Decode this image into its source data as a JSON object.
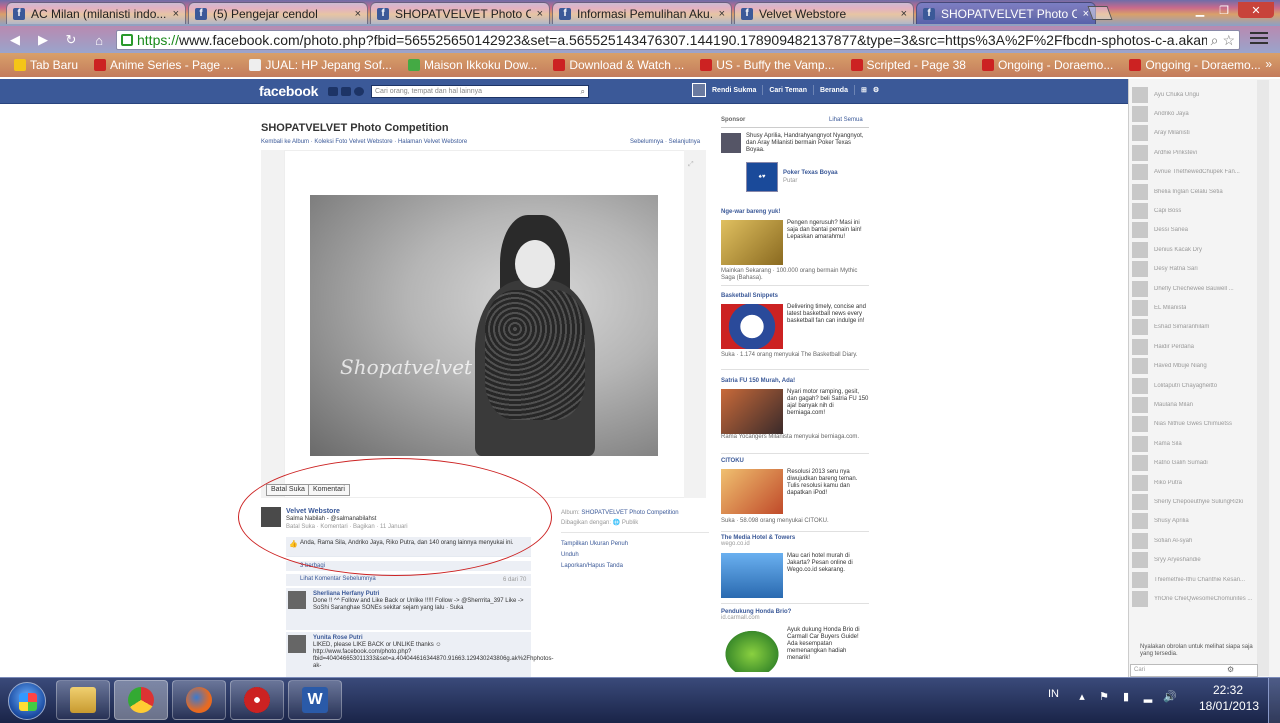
{
  "browser": {
    "tabs": [
      {
        "title": "AC Milan (milanisti indo..."
      },
      {
        "title": "(5) Pengejar cendol"
      },
      {
        "title": "SHOPATVELVET Photo C..."
      },
      {
        "title": "Informasi Pemulihan Aku..."
      },
      {
        "title": "Velvet Webstore"
      },
      {
        "title": "SHOPATVELVET Photo C..."
      }
    ],
    "close_glyph": "×",
    "url_scheme": "https://",
    "url_rest": "www.facebook.com/photo.php?fbid=565525650142923&set=a.565525143476307.144190.178909482137877&type=3&src=https%3A%2F%2Ffbcdn-sphotos-c-a.akam",
    "bookmarks": [
      {
        "label": "Tab Baru",
        "color": "#f5c518"
      },
      {
        "label": "Anime Series - Page ...",
        "color": "#cc2222"
      },
      {
        "label": "JUAL: HP Jepang Sof...",
        "color": "#eeeeee"
      },
      {
        "label": "Maison Ikkoku Dow...",
        "color": "#44aa44"
      },
      {
        "label": "Download & Watch ...",
        "color": "#cc2222"
      },
      {
        "label": "US - Buffy the Vamp...",
        "color": "#cc2222"
      },
      {
        "label": "Scripted - Page 38",
        "color": "#cc2222"
      },
      {
        "label": "Ongoing - Doraemo...",
        "color": "#cc2222"
      },
      {
        "label": "Ongoing - Doraemo...",
        "color": "#cc2222"
      }
    ],
    "bookmarks_more": "»"
  },
  "fb": {
    "logo": "facebook",
    "search_placeholder": "Cari orang, tempat dan hal lainnya",
    "nav_user": "Rendi Sukma",
    "nav_friends": "Cari Teman",
    "nav_home": "Beranda",
    "photo_title": "SHOPATVELVET Photo Competition",
    "breadcrumbs": "Kembali ke Album · Koleksi Foto Velvet Webstore · Halaman Velvet Webstore",
    "pager": "Sebelumnya · Selanjutnya",
    "watermark": "Shopatvelvet",
    "btn_unlike": "Batal Suka",
    "btn_comment": "Komentari",
    "poster_name": "Velvet Webstore",
    "poster_text": "Salma Nabilah - @salmanabilahst",
    "poster_meta": "Batal Suka · Komentari · Bagikan · 11 Januari",
    "likes_text": "Anda, Rama Sila, Andriko Jaya, Riko Putra, dan 140 orang lainnya menyukai ini.",
    "share_text": "3 berbagi",
    "prev_comments": "Lihat Komentar Sebelumnya",
    "prev_count": "6 dari 70",
    "album_label": "Album:",
    "album_name": "SHOPATVELVET Photo Competition",
    "shared_label": "Dibagikan dengan:",
    "shared_value": "Publik",
    "side_links": [
      "Tampilkan Ukuran Penuh",
      "Unduh",
      "Laporkan/Hapus Tanda"
    ],
    "comments": [
      {
        "name": "Sherliana Herfany Putri",
        "text": "Done !! ^^ Follow and Like Back or Unlike !!!!! Follow -> @Sherrrita_397 Like -> SoShi Saranghae SONEs sekitar sejam yang lalu · Suka",
        "highlight": "Done !! ^^"
      },
      {
        "name": "Yunita Rose Putri",
        "text": "LIKED, please LIKE BACK or UNLIKE thanks ☺ http://www.facebook.com/photo.php?fbid=404046653011333&set=a.404044616344870.91663.129430243806g.ak%2Fhphotos-ak-",
        "highlight": "LIKED, please LIKE BACK or UNLIKE thanks"
      }
    ]
  },
  "sponsor": {
    "head": "Sponsor",
    "see_all": "Lihat Semua",
    "social": {
      "name": "Shusy Aprilia",
      "text": "Shusy Aprilia, Handrahyangnyot Nyangnyot, dan Aray Milanisti bermain Poker Texas Boyaa."
    },
    "poker": {
      "name": "Poker Texas Boyaa",
      "action": "Putar"
    },
    "ads": [
      {
        "title": "Nge-war bareng yuk!",
        "sub": "",
        "desc": "Pengen ngerusuh? Masi ini saja dan bantai pemain lain! Lepaskan amarahmu!",
        "foot": "Mainkan Sekarang · 100.000 orang bermain Mythic Saga (Bahasa).",
        "color": "#c8a040"
      },
      {
        "title": "Basketball Snippets",
        "sub": "",
        "desc": "Delivering timely, concise and latest basketball news every basketball fan can indulge in!",
        "foot": "Suka · 1.174 orang menyukai The Basketball Diary.",
        "color": "#2a4a9a"
      },
      {
        "title": "Satria FU 150 Murah, Ada!",
        "sub": "",
        "desc": "Nyari motor ramping, gesit, dan gagah? beli Satria FU 150 aja! banyak nih di berniaga.com!",
        "foot": "Rama Yocangers Milanista menyukai berniaga.com.",
        "color": "#8a3a2a"
      },
      {
        "title": "CITOKU",
        "sub": "",
        "desc": "Resolusi 2013 seru nya diwujudkan bareng teman. Tulis resolusi kamu dan dapatkan iPod!",
        "foot": "Suka · 58.098 orang menyukai CITOKU.",
        "color": "#d8a050"
      },
      {
        "title": "The Media Hotel & Towers",
        "sub": "wego.co.id",
        "desc": "Mau cari hotel murah di Jakarta? Pesan online di Wego.co.id sekarang.",
        "foot": "",
        "color": "#3a8ad8"
      },
      {
        "title": "Pendukung Honda Brio?",
        "sub": "id.carmall.com",
        "desc": "Ayuk dukung Honda Brio di Carmall Car Buyers Guide! Ada kesempatan memenangkan hadiah menarik!",
        "foot": "",
        "color": "#6ac040"
      }
    ]
  },
  "chat": {
    "friends": [
      "Ayu Chuka Ungu",
      "Andriko Jaya",
      "Aray Milanisti",
      "Ardhie Pinkstevi",
      "Avnue ThethewedChupek Fan...",
      "Bhelia Inglan Celalu Setia",
      "Capi Boss",
      "Dessi Sanea",
      "Denius Kacak Dry",
      "Desy Ratna Sari",
      "Dhefly Chechewee Bauwell ...",
      "EL Milanista",
      "Eshad Simaranhilam",
      "Haidir Perdana",
      "Haved Mbuje Niang",
      "Lolitaputri Chayagheitto",
      "Maulana Milan",
      "Nias Nithue Gwes Chimuetss",
      "Rama Sila",
      "Ratno Galih Sumadi",
      "Riko Putra",
      "Sherly Chepoeuthyie SulungRizki",
      "Shusy Aprilia",
      "Sofian Al-syah",
      "Sryy Aryeshandie",
      "Thiemethie-Ithu Chanthie Kesan...",
      "YhOne ChieQwesomeChomunites ..."
    ],
    "message": "Nyalakan obrolan untuk melihat siapa saja yang tersedia.",
    "search_placeholder": "Cari"
  },
  "taskbar": {
    "lang": "IN",
    "time": "22:32",
    "date": "18/01/2013"
  }
}
